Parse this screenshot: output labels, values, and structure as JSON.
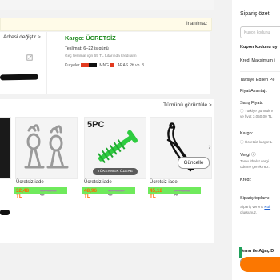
{
  "notice": {
    "text": "Inanılmaz"
  },
  "address": {
    "change_label": "Adresi değiştir",
    "chevron": ">"
  },
  "shipping": {
    "title": "Kargo: ÜCRETSİZ",
    "delivery": "Teslimat: 6–22 iş günü",
    "late_note": "Geç teslimat için 65 TL tutarında kredi alın",
    "couriers_label": "Kuryeler",
    "courier_names": [
      "MNG",
      "ARAS",
      "Ptt",
      "vb. 3"
    ]
  },
  "products": {
    "view_all": "Tümünü görüntüle",
    "next_icon": "chevron-right-icon",
    "items": [
      {
        "free_shipping": "Ücretsiz iade",
        "price": "32,48 TL",
        "old_price": "TRY98,54 TL"
      },
      {
        "badge": "5PC",
        "stock_badge": "TÜKENMEK ÜZERE",
        "free_shipping": "Ücretsiz iade",
        "price": "48,96 TL",
        "old_price": "TRY96,27 TL"
      },
      {
        "free_shipping": "Ücretsiz iade",
        "price": "45,12 TL",
        "old_price": "TRY62,02 TL"
      }
    ],
    "update_label": "Güncelle"
  },
  "summary": {
    "title": "Sipariş özeti",
    "coupon_placeholder": "Kupon kodunu",
    "coupon_label": "Kupon kodunu uy",
    "credit": "Kredi  Maksimum i",
    "recommended": "Tavsiye Edilen Pe",
    "price_advantage": "Fiyat Avantajı:",
    "sale_price": "Satış Fiyatı:",
    "sale_note_1": "ⓘ Türkiye gümrük v",
    "sale_note_2": "ve fiyat 3.050,00 TL",
    "shipping": "Kargo:",
    "shipping_note": "ⓘ Ücretsiz kargo! L",
    "tax": "Vergi",
    "tax_note_1": "Temu ithalat vergi",
    "tax_note_2": "ödeme gerekmez.",
    "credit_total": "Kredi:",
    "order_total": "Sipariş toplamı:",
    "order_note_1": "Sipariş verenk ",
    "order_note_link": "Kull",
    "order_note_2": "olursunuz.",
    "tree": "Temu ile Ağaç D",
    "tree_note_1": "Şeni 12,23 TL",
    "tree_note_2": "ediyoruz ⓘ"
  }
}
